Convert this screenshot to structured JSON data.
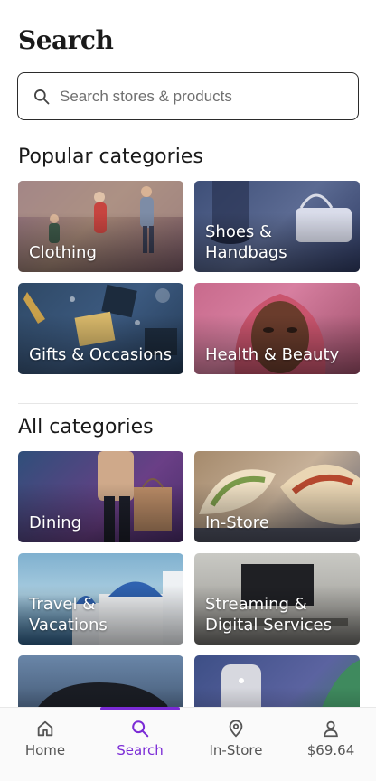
{
  "page": {
    "title": "Search"
  },
  "search": {
    "placeholder": "Search stores & products"
  },
  "popular": {
    "heading": "Popular categories",
    "tiles": [
      {
        "label": "Clothing",
        "icon": "photo-family-walk"
      },
      {
        "label": "Shoes & Handbags",
        "icon": "photo-handbag"
      },
      {
        "label": "Gifts & Occasions",
        "icon": "photo-gift-wrap"
      },
      {
        "label": "Health & Beauty",
        "icon": "photo-portrait"
      }
    ]
  },
  "all": {
    "heading": "All categories",
    "tiles": [
      {
        "label": "Dining",
        "icon": "photo-shopper-bags"
      },
      {
        "label": "In-Store",
        "icon": "photo-tacos"
      },
      {
        "label": "Travel & Vacations",
        "icon": "photo-santorini"
      },
      {
        "label": "Streaming & Digital Services",
        "icon": "photo-tv-room"
      },
      {
        "label": "",
        "icon": "photo-car"
      },
      {
        "label": "",
        "icon": "photo-smart-speaker"
      }
    ]
  },
  "nav": {
    "active_color": "#7b2bd6",
    "items": [
      {
        "label": "Home",
        "icon": "home-icon"
      },
      {
        "label": "Search",
        "icon": "search-icon",
        "active": true
      },
      {
        "label": "In-Store",
        "icon": "location-pin-icon"
      },
      {
        "label": "$69.64",
        "icon": "person-icon"
      }
    ]
  }
}
